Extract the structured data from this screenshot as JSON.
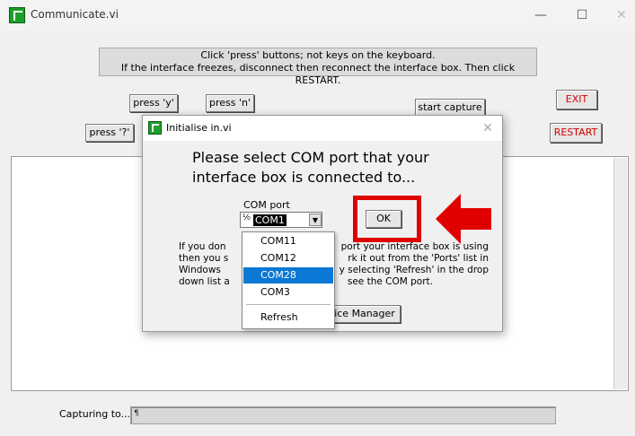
{
  "window": {
    "title": "Communicate.vi",
    "minimize_icon": "—",
    "maximize_icon": "☐",
    "close_icon": "✕"
  },
  "instructions": {
    "line1": "Click 'press' buttons; not keys on the keyboard.",
    "line2": "If the interface freezes, disconnect then reconnect the interface box. Then click RESTART."
  },
  "buttons": {
    "press_y": "press 'y'",
    "press_n": "press 'n'",
    "press_q": "press '?'",
    "start_capture": "start capture",
    "exit": "EXIT",
    "restart": "RESTART"
  },
  "capture": {
    "label": "Capturing to...",
    "path_glyph": "¶"
  },
  "dialog": {
    "title": "Initialise in.vi",
    "close_icon": "✕",
    "prompt": "Please select COM port that your interface box is connected to...",
    "com_label": "COM port",
    "com_glyph": "⅟₀",
    "com_value": "COM1",
    "ok_label": "OK",
    "help_lines": [
      "If you don",
      "then you s",
      "Windows ",
      "down list a"
    ],
    "help_right_lines": [
      "port your interface box is using",
      "rk it out from the 'Ports' list in",
      "y selecting 'Refresh' in the drop",
      "see the COM port."
    ],
    "device_manager_label": "ice Manager",
    "dropdown": {
      "options": [
        "COM11",
        "COM12",
        "COM28",
        "COM3"
      ],
      "selected": "COM28",
      "refresh": "Refresh"
    }
  },
  "colors": {
    "highlight": "#e00000",
    "selection": "#0a78d4",
    "exit_text": "#d40000"
  }
}
